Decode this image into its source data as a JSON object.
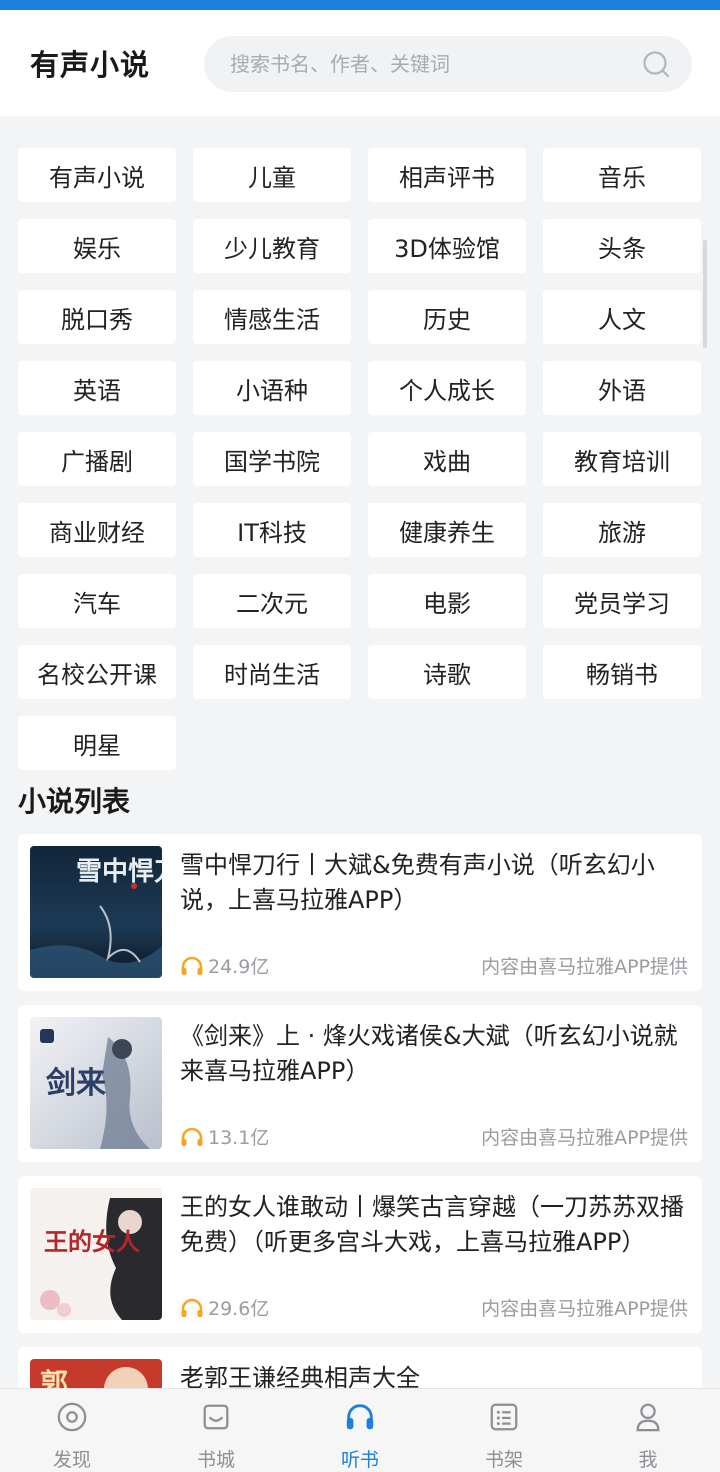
{
  "header": {
    "title": "有声小说",
    "search_placeholder": "搜索书名、作者、关键词",
    "search_icon": "search-icon"
  },
  "categories": [
    "有声小说",
    "儿童",
    "相声评书",
    "音乐",
    "娱乐",
    "少儿教育",
    "3D体验馆",
    "头条",
    "脱口秀",
    "情感生活",
    "历史",
    "人文",
    "英语",
    "小语种",
    "个人成长",
    "外语",
    "广播剧",
    "国学书院",
    "戏曲",
    "教育培训",
    "商业财经",
    "IT科技",
    "健康养生",
    "旅游",
    "汽车",
    "二次元",
    "电影",
    "党员学习",
    "名校公开课",
    "时尚生活",
    "诗歌",
    "畅销书",
    "明星"
  ],
  "section": {
    "title": "小说列表"
  },
  "books": [
    {
      "title": "雪中悍刀行丨大斌&免费有声小说（听玄幻小说，上喜马拉雅APP）",
      "plays": "24.9亿",
      "source": "内容由喜马拉雅APP提供",
      "cover_text": "雪中悍刀行"
    },
    {
      "title": "《剑来》上 · 烽火戏诸侯&大斌（听玄幻小说就来喜马拉雅APP）",
      "plays": "13.1亿",
      "source": "内容由喜马拉雅APP提供",
      "cover_text": "剑来"
    },
    {
      "title": "王的女人谁敢动丨爆笑古言穿越（一刀苏苏双播免费）（听更多宫斗大戏，上喜马拉雅APP）",
      "plays": "29.6亿",
      "source": "内容由喜马拉雅APP提供",
      "cover_text": "王的女人"
    },
    {
      "title": "老郭王谦经典相声大全",
      "plays": "",
      "source": "",
      "cover_text": "郭"
    }
  ],
  "tabbar": [
    {
      "label": "发现",
      "icon": "compass-icon",
      "active": false
    },
    {
      "label": "书城",
      "icon": "bag-icon",
      "active": false
    },
    {
      "label": "听书",
      "icon": "headphones-icon",
      "active": true
    },
    {
      "label": "书架",
      "icon": "list-icon",
      "active": false
    },
    {
      "label": "我",
      "icon": "user-icon",
      "active": false
    }
  ],
  "colors": {
    "accent": "#1c7fdc",
    "play_icon": "#f5a623",
    "background": "#f3f4f6"
  }
}
